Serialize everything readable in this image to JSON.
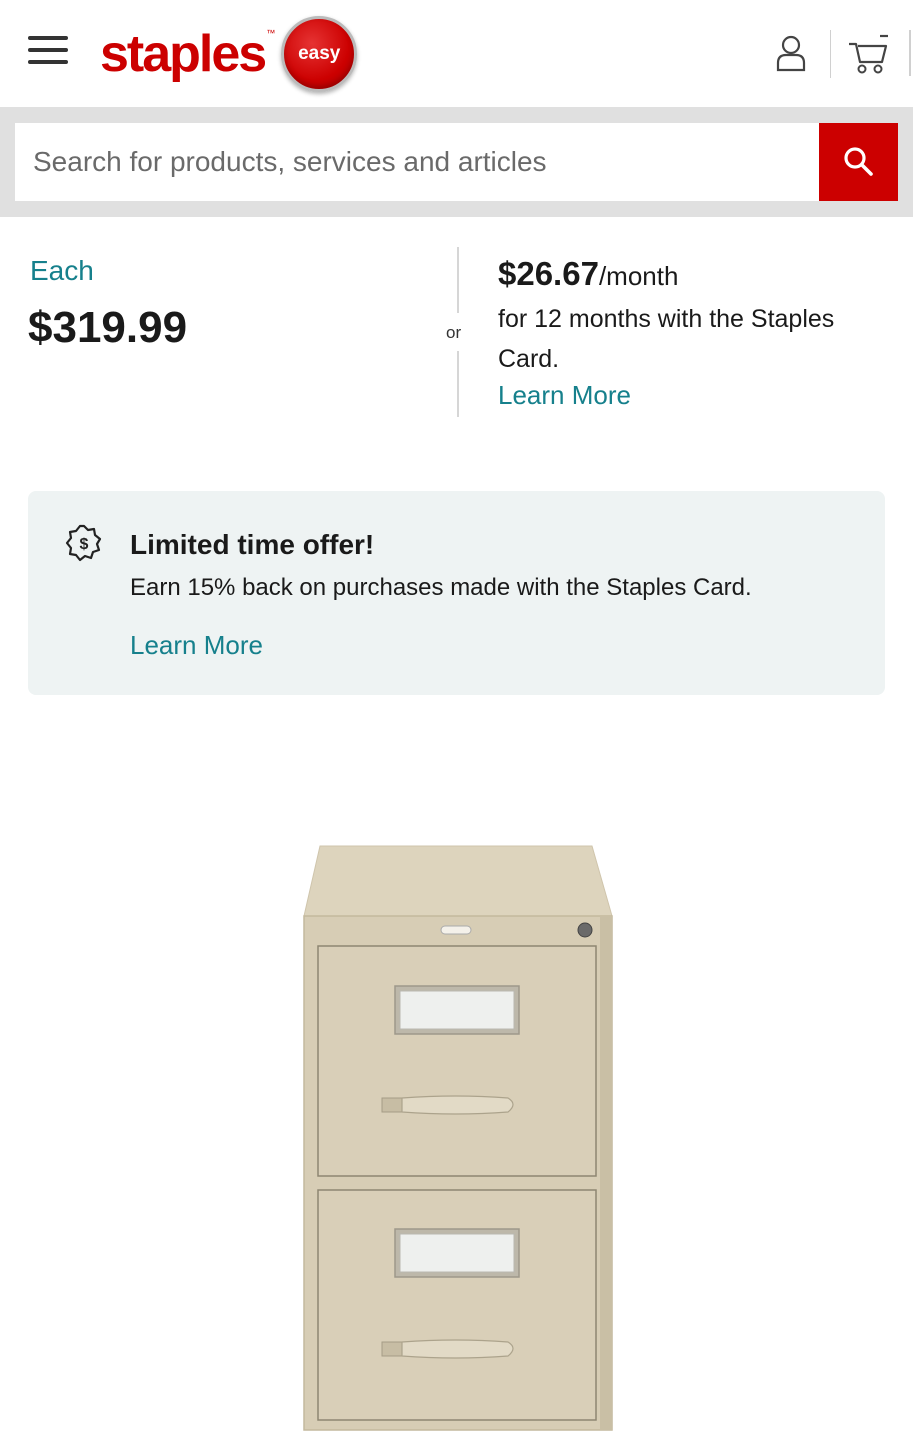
{
  "header": {
    "logo_text": "staples",
    "logo_tm": "™",
    "easy_badge": "easy",
    "icons": {
      "menu": "hamburger-menu-icon",
      "account": "user-icon",
      "cart": "shopping-cart-icon"
    }
  },
  "search": {
    "placeholder": "Search for products, services and articles",
    "button_icon": "search-icon"
  },
  "pricing": {
    "each_label": "Each",
    "price": "$319.99",
    "or_label": "or",
    "monthly_amount": "$26.67",
    "monthly_unit": "/month",
    "monthly_desc": "for 12 months with the Staples Card.",
    "learn_more": "Learn More"
  },
  "offer": {
    "icon": "dollar-badge-icon",
    "title": "Limited time offer!",
    "description": "Earn 15% back on purchases made with the Staples Card.",
    "learn_more": "Learn More"
  },
  "product": {
    "image_name": "file-cabinet-image"
  },
  "colors": {
    "brand_red": "#cc0000",
    "link_teal": "#16808c",
    "offer_bg": "#eef3f3",
    "cabinet": "#d7cdb5"
  }
}
